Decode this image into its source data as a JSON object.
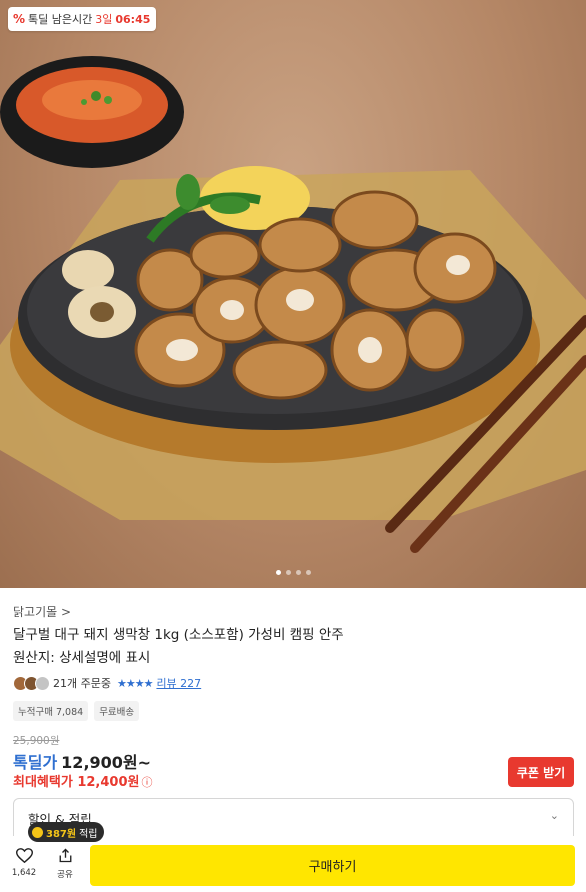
{
  "deal_badge": {
    "icon": "percent-icon",
    "label": "톡딜 남은시간",
    "days": "3일",
    "time": "06:45"
  },
  "carousel": {
    "current": 1,
    "total": 4
  },
  "product": {
    "breadcrumb": "닭고기몰 >",
    "title": "달구벌 대구 돼지 생막창 1kg (소스포함) 가성비 캠핑 안주",
    "origin": "원산지: 상세설명에 표시",
    "order_count": "21개 주문중",
    "stars": "★★★★",
    "review_label": "리뷰 227",
    "tags": [
      "누적구매 7,084",
      "무료배송"
    ]
  },
  "price": {
    "original": "25,900원",
    "deal_label": "톡딜가",
    "deal_price": "12,900원~",
    "max_benefit": "최대혜택가 12,400원",
    "info_icon": "ⓘ"
  },
  "coupon_button": "쿠폰 받기",
  "benefit": {
    "label": "할인 & 적립",
    "chevron": "⌄"
  },
  "points": {
    "amount": "387원",
    "label": "적립"
  },
  "bottom": {
    "like_count": "1,642",
    "share_label": "공유",
    "buy_label": "구매하기"
  },
  "colors": {
    "accent_red": "#e8392f",
    "accent_blue": "#2f6fd0",
    "buy_yellow": "#ffe600"
  }
}
